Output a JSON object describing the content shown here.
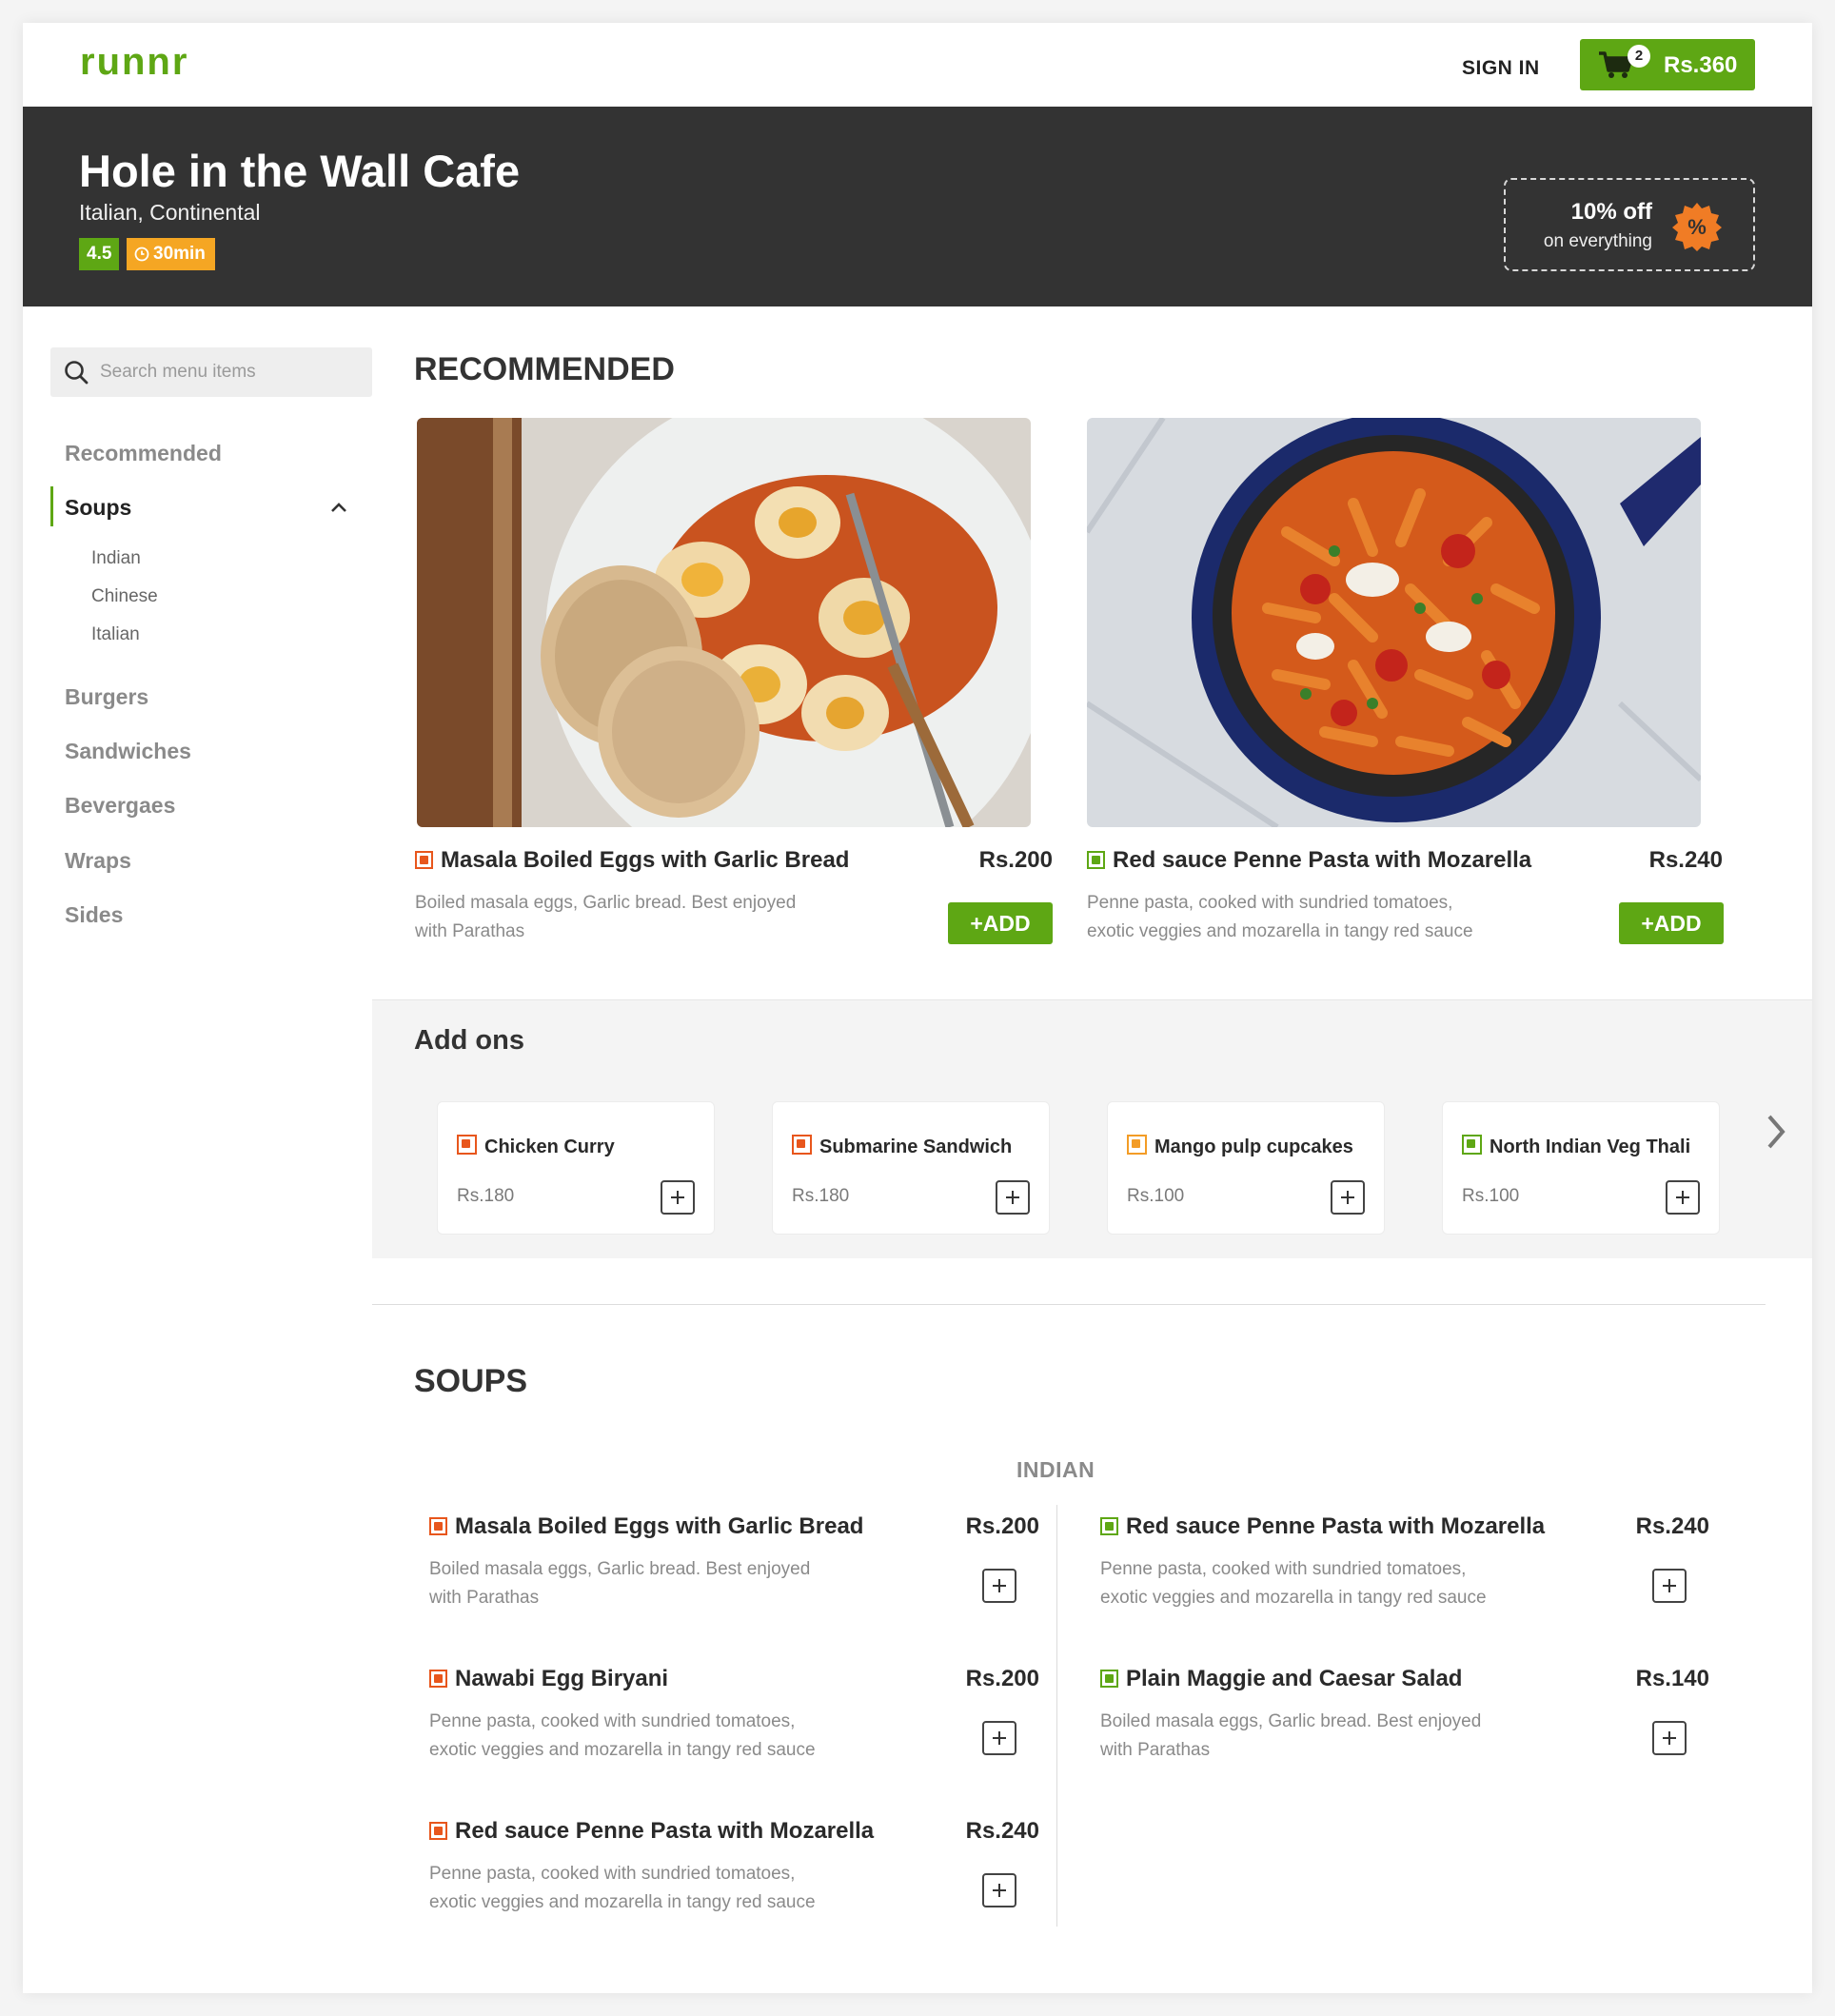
{
  "header": {
    "logo": "runnr",
    "sign_in": "SIGN IN",
    "cart_count": "2",
    "cart_total": "Rs.360",
    "brand_color": "#5ea714"
  },
  "restaurant": {
    "name": "Hole in the Wall Cafe",
    "cuisine": "Italian, Continental",
    "rating": "4.5",
    "eta": "30min",
    "offer_title": "10% off",
    "offer_sub": "on everything",
    "offer_badge_icon": "percent-icon"
  },
  "sidebar": {
    "search_placeholder": "Search menu items",
    "items": [
      {
        "label": "Recommended"
      },
      {
        "label": "Soups"
      },
      {
        "label": "Burgers"
      },
      {
        "label": "Sandwiches"
      },
      {
        "label": "Bevergaes"
      },
      {
        "label": "Wraps"
      },
      {
        "label": "Sides"
      }
    ],
    "soup_subitems": [
      "Indian",
      "Chinese",
      "Italian"
    ]
  },
  "recommended": {
    "title": "RECOMMENDED",
    "add_label": "+ADD",
    "items": [
      {
        "name": "Masala Boiled Eggs with Garlic Bread",
        "price": "Rs.200",
        "desc_line1": "Boiled masala eggs, Garlic bread. Best enjoyed",
        "desc_line2": "with Parathas",
        "type": "non-veg"
      },
      {
        "name": "Red sauce Penne Pasta with Mozarella",
        "price": "Rs.240",
        "desc_line1": "Penne pasta, cooked with sundried tomatoes,",
        "desc_line2": "exotic veggies and mozarella in tangy red sauce",
        "type": "veg"
      }
    ]
  },
  "addons": {
    "title": "Add ons",
    "items": [
      {
        "name": "Chicken Curry",
        "price": "Rs.180"
      },
      {
        "name": "Submarine Sandwich",
        "price": "Rs.180"
      },
      {
        "name": "Mango pulp cupcakes",
        "price": "Rs.100"
      },
      {
        "name": "North Indian Veg Thali",
        "price": "Rs.100"
      }
    ]
  },
  "soups": {
    "title": "SOUPS",
    "subsection": "INDIAN",
    "left": [
      {
        "name": "Masala Boiled Eggs with Garlic Bread",
        "price": "Rs.200",
        "desc_line1": "Boiled masala eggs, Garlic bread. Best enjoyed",
        "desc_line2": "with Parathas"
      },
      {
        "name": "Nawabi Egg Biryani",
        "price": "Rs.200",
        "desc_line1": "Penne pasta, cooked with sundried tomatoes,",
        "desc_line2": "exotic veggies and mozarella in tangy red sauce"
      },
      {
        "name": "Red sauce Penne Pasta with Mozarella",
        "price": "Rs.240",
        "desc_line1": "Penne pasta, cooked with sundried tomatoes,",
        "desc_line2": "exotic veggies and mozarella in tangy red sauce"
      }
    ],
    "right": [
      {
        "name": "Red sauce Penne Pasta with Mozarella",
        "price": "Rs.240",
        "desc_line1": "Penne pasta, cooked with sundried tomatoes,",
        "desc_line2": "exotic veggies and mozarella in tangy red sauce"
      },
      {
        "name": "Plain Maggie and Caesar Salad",
        "price": "Rs.140",
        "desc_line1": "Boiled masala eggs, Garlic bread. Best enjoyed",
        "desc_line2": "with Parathas"
      }
    ]
  }
}
